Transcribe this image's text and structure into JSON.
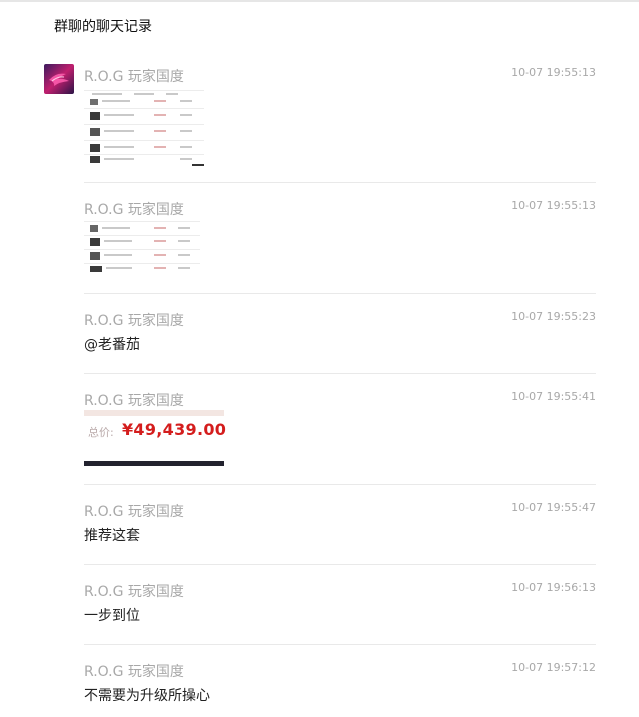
{
  "window": {
    "title": "群聊的聊天记录"
  },
  "colors": {
    "accent_price": "#d41d1d",
    "muted_text": "#a8a8a8",
    "divider": "#e9e9e9"
  },
  "messages": [
    {
      "sender": "R.O.G 玩家国度",
      "time": "10-07 19:55:13",
      "type": "image",
      "content": "order-list-screenshot"
    },
    {
      "sender": "R.O.G 玩家国度",
      "time": "10-07 19:55:13",
      "type": "image",
      "content": "order-list-screenshot"
    },
    {
      "sender": "R.O.G 玩家国度",
      "time": "10-07 19:55:23",
      "type": "text",
      "content": "@老番茄"
    },
    {
      "sender": "R.O.G 玩家国度",
      "time": "10-07 19:55:41",
      "type": "image",
      "content": "price-screenshot"
    },
    {
      "sender": "R.O.G 玩家国度",
      "time": "10-07 19:55:47",
      "type": "text",
      "content": "推荐这套"
    },
    {
      "sender": "R.O.G 玩家国度",
      "time": "10-07 19:56:13",
      "type": "text",
      "content": "一步到位"
    },
    {
      "sender": "R.O.G 玩家国度",
      "time": "10-07 19:57:12",
      "type": "text",
      "content": "不需要为升级所操心"
    }
  ],
  "price_image": {
    "label": "总价:",
    "amount": "¥49,439.00"
  },
  "avatar": {
    "icon": "rog-logo-icon"
  }
}
